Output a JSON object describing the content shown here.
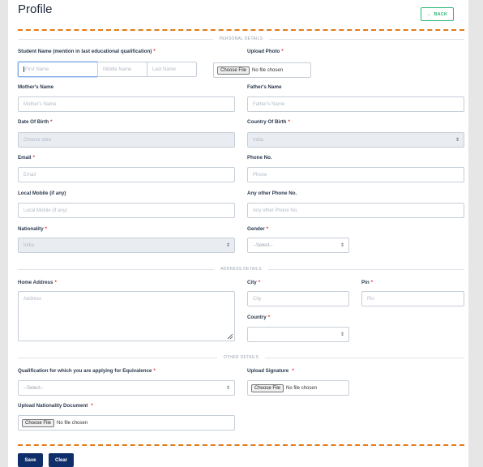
{
  "header": {
    "title": "Profile",
    "back_button": {
      "label": "BACK",
      "icon": "arrow-left-icon",
      "color": "#2bb673"
    }
  },
  "sections": {
    "personal": "PERSONAL DETAILS",
    "address": "ADDRESS DETAILS",
    "other": "OTHER DETAILS"
  },
  "fields": {
    "student_name": {
      "label": "Student Name (mention in last educational qualification)",
      "required": "*",
      "first_placeholder": "First Name",
      "middle_placeholder": "Middle Name",
      "last_placeholder": "Last Name"
    },
    "upload_photo": {
      "label": "Upload Photo",
      "required": "*",
      "button": "Choose File",
      "status": "No file chosen"
    },
    "mothers_name": {
      "label": "Mother's Name",
      "placeholder": "Mother's Name"
    },
    "fathers_name": {
      "label": "Father's Name",
      "placeholder": "Father's Name"
    },
    "dob": {
      "label": "Date Of Birth",
      "required": "*",
      "placeholder": "Choose date"
    },
    "country_of_birth": {
      "label": "Country Of Birth",
      "required": "*",
      "value": "India"
    },
    "email": {
      "label": "Email",
      "required": "*",
      "placeholder": "Email"
    },
    "phone": {
      "label": "Phone No.",
      "placeholder": "Phone"
    },
    "local_mobile": {
      "label": "Local Mobile (if any)",
      "placeholder": "Local Mobile (if any)"
    },
    "other_phone": {
      "label": "Any other Phone No.",
      "placeholder": "Any other Phone No."
    },
    "nationality": {
      "label": "Nationality",
      "required": "*",
      "value": "India"
    },
    "gender": {
      "label": "Gender",
      "required": "*",
      "value": "--Select--"
    },
    "home_address": {
      "label": "Home Address",
      "required": "*",
      "placeholder": "Address"
    },
    "city": {
      "label": "City",
      "required": "*",
      "placeholder": "City"
    },
    "pin": {
      "label": "Pin",
      "required": "*",
      "placeholder": "Pin"
    },
    "country": {
      "label": "Country",
      "required": "*",
      "value": ""
    },
    "qualification": {
      "label": "Qualification for which you are applying for Equivalence",
      "required": "*",
      "value": "--Select--"
    },
    "upload_signature": {
      "label": "Upload Signature",
      "required": "*",
      "button": "Choose File",
      "status": "No file chosen"
    },
    "upload_nationality": {
      "label": "Upload Nationality Document",
      "required": "*",
      "button": "Choose File",
      "status": "No file chosen"
    }
  },
  "actions": {
    "save": "Save",
    "clear": "Clear"
  },
  "colors": {
    "accent_dash": "#e07b1a",
    "primary": "#0f2f6b",
    "required": "#e3342f"
  }
}
